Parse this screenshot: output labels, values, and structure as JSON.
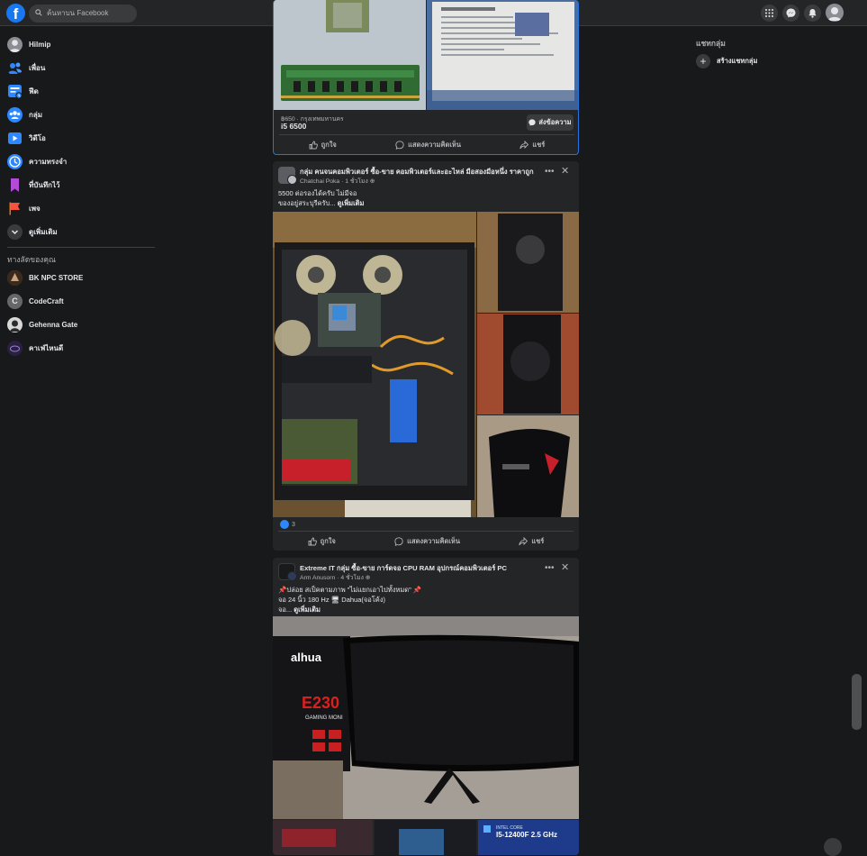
{
  "topbar": {
    "logo": "f",
    "search_placeholder": "ค้นหาบน Facebook",
    "nav_icons": [
      "home-icon",
      "friends-icon",
      "watch-icon",
      "groups-icon",
      "gaming-icon"
    ],
    "right_icons": [
      "menu-grid-icon",
      "messenger-icon",
      "bell-icon",
      "account-icon"
    ]
  },
  "sidebar": {
    "items": [
      {
        "label": "Hilmip",
        "icon": "profile-avatar"
      },
      {
        "label": "เพื่อน",
        "icon": "friends-icon"
      },
      {
        "label": "ฟีด",
        "icon": "feed-icon"
      },
      {
        "label": "กลุ่ม",
        "icon": "groups-icon"
      },
      {
        "label": "วิดีโอ",
        "icon": "video-icon"
      },
      {
        "label": "ความทรงจำ",
        "icon": "memories-icon"
      },
      {
        "label": "ที่บันทึกไว้",
        "icon": "saved-icon"
      },
      {
        "label": "เพจ",
        "icon": "pages-icon"
      },
      {
        "label": "ดูเพิ่มเติม",
        "icon": "chevron-down-icon"
      }
    ],
    "shortcuts_header": "ทางลัดของคุณ",
    "shortcuts": [
      {
        "label": "BK NPC STORE"
      },
      {
        "label": "CodeCraft",
        "initial": "C"
      },
      {
        "label": "Gehenna Gate"
      },
      {
        "label": "คาเฟ่ไหนดี"
      }
    ]
  },
  "marketplace_post": {
    "price_location": "฿650 · กรุงเทพมหานคร",
    "title": "i5 6500",
    "message_button": "ส่งข้อความ",
    "actions": {
      "like": "ถูกใจ",
      "comment": "แสดงความคิดเห็น",
      "share": "แชร์"
    }
  },
  "post2": {
    "group": "กลุ่ม คนจนคอมพิวเตอร์ ซื้อ-ขาย คอมพิวเตอร์และอะไหล่ มือสองมือหนึ่ง ราคาถูก",
    "author": "Chatchai Poka",
    "time": "1 ชั่วโมง",
    "text_line1": "5500 ต่อรองได้ครับ ไม่มีจอ",
    "text_line2": "ของอยู่สระบุรีครับ...",
    "see_more": "ดูเพิ่มเติม",
    "reaction_count": "3",
    "actions": {
      "like": "ถูกใจ",
      "comment": "แสดงความคิดเห็น",
      "share": "แชร์"
    }
  },
  "post3": {
    "group": "Extreme IT กลุ่ม ซื้อ-ขาย การ์ดจอ CPU RAM อุปกรณ์คอมพิวเตอร์ PC",
    "author": "Arm Anusorn",
    "time": "4 ชั่วโมง",
    "text_line1": "📌ปล่อย สเป็คตามภาพ \"ไม่แยกเอาไปทั้งหมด\" 📌",
    "text_line2": "จอ 24 นิ้ว 180 Hz 🖥 Dahua(จอโค้ง)",
    "text_line3": "จอ...",
    "see_more": "ดูเพิ่มเติม",
    "image_labels": {
      "brand": "alhua",
      "model": "E230",
      "series": "GAMING MONI",
      "cpu_label_top": "INTEL CORE",
      "cpu_label": "I5-12400F 2.5 GHz"
    }
  },
  "right_panel": {
    "title": "แชทกลุ่ม",
    "create_label": "สร้างแชทกลุ่ม"
  }
}
